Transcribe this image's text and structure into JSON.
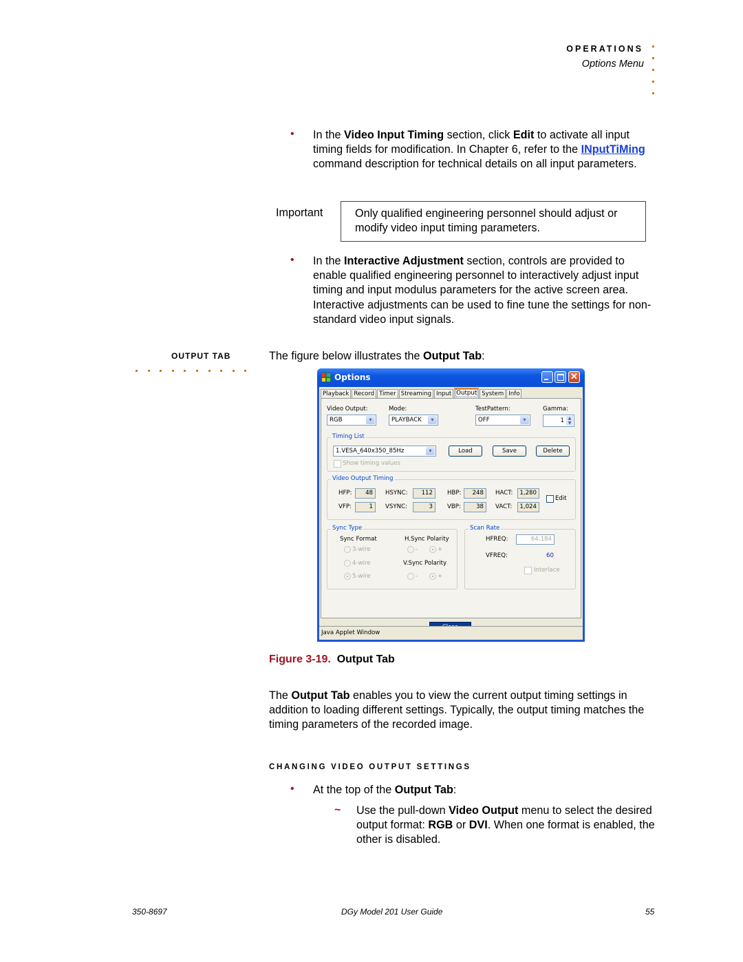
{
  "header": {
    "section": "OPERATIONS",
    "subsection": "Options Menu"
  },
  "bullets_top": [
    {
      "pre": "In the ",
      "bold1": "Video Input Timing",
      "mid1": " section, click ",
      "bold2": "Edit",
      "mid2": " to activate all input timing fields for modification. In Chapter 6, refer to the ",
      "link": "INputTiMing",
      "post": " command description for technical details on all input parameters."
    },
    {
      "pre": "In the ",
      "bold1": "Interactive Adjustment",
      "post": " section, controls are provided to enable qualified engineering personnel to interactively adjust input timing and input modulus parameters for the active screen area. Interactive adjustments can be used to fine tune the settings for non-standard video input signals."
    }
  ],
  "important": {
    "label": "Important",
    "text": "Only qualified engineering personnel should adjust or modify video input timing parameters."
  },
  "output_tab_section": {
    "side_heading": "OUTPUT TAB",
    "intro_pre": "The figure below illustrates the ",
    "intro_bold": "Output Tab",
    "intro_post": ":"
  },
  "dialog": {
    "title": "Options",
    "tabs": [
      "Playback",
      "Record",
      "Timer",
      "Streaming",
      "Input",
      "Output",
      "System",
      "Info"
    ],
    "active_tab": "Output",
    "video_output": {
      "label": "Video Output:",
      "value": "RGB"
    },
    "mode": {
      "label": "Mode:",
      "value": "PLAYBACK"
    },
    "test_pattern": {
      "label": "TestPattern:",
      "value": "OFF"
    },
    "gamma": {
      "label": "Gamma:",
      "value": "1"
    },
    "timing_list": {
      "legend": "Timing List",
      "selected": "1.VESA_640x350_85Hz",
      "load": "Load",
      "save": "Save",
      "delete": "Delete",
      "show_values": "Show timing values"
    },
    "video_output_timing": {
      "legend": "Video Output Timing",
      "fields": {
        "hfp": {
          "label": "HFP:",
          "value": "48"
        },
        "vfp": {
          "label": "VFP:",
          "value": "1"
        },
        "hsync": {
          "label": "HSYNC:",
          "value": "112"
        },
        "vsync": {
          "label": "VSYNC:",
          "value": "3"
        },
        "hbp": {
          "label": "HBP:",
          "value": "248"
        },
        "vbp": {
          "label": "VBP:",
          "value": "38"
        },
        "hact": {
          "label": "HACT:",
          "value": "1,280"
        },
        "vact": {
          "label": "VACT:",
          "value": "1,024"
        }
      },
      "edit": "Edit"
    },
    "sync_type": {
      "legend": "Sync Type",
      "format_label": "Sync Format",
      "options": [
        "3-wire",
        "4-wire",
        "5-wire"
      ],
      "selected": "5-wire",
      "hpol_label": "H.Sync Polarity",
      "vpol_label": "V.Sync Polarity",
      "minus": "-",
      "plus": "+"
    },
    "scan_rate": {
      "legend": "Scan Rate",
      "hfreq_label": "HFREQ:",
      "hfreq": "64,184",
      "vfreq_label": "VFREQ:",
      "vfreq": "60",
      "interlace": "Interlace"
    },
    "close": "Close",
    "status": "Java Applet Window"
  },
  "figure": {
    "number": "Figure 3-19.",
    "title": "Output Tab"
  },
  "description": {
    "pre": "The ",
    "bold": "Output Tab",
    "post": " enables you to view the current output timing settings in addition to loading different settings. Typically, the output timing matches the timing parameters of the recorded image."
  },
  "changing": {
    "heading": "CHANGING VIDEO OUTPUT SETTINGS",
    "bullet_pre": "At the top of the ",
    "bullet_bold": "Output Tab",
    "bullet_post": ":",
    "sub_pre": "Use the pull-down ",
    "sub_bold1": "Video Output",
    "sub_mid1": " menu to select the desired output format: ",
    "sub_bold2": "RGB",
    "sub_mid2": " or ",
    "sub_bold3": "DVI",
    "sub_post": ". When one format is enabled, the other is disabled."
  },
  "footer": {
    "doc_number": "350-8697",
    "guide_title": "DGy Model 201 User Guide",
    "page": "55"
  },
  "colors": {
    "accent_orange": "#d2781e",
    "bullet_red": "#a0141e",
    "link_blue": "#1a3fd4",
    "xp_title_blue": "#0a4fd6"
  }
}
